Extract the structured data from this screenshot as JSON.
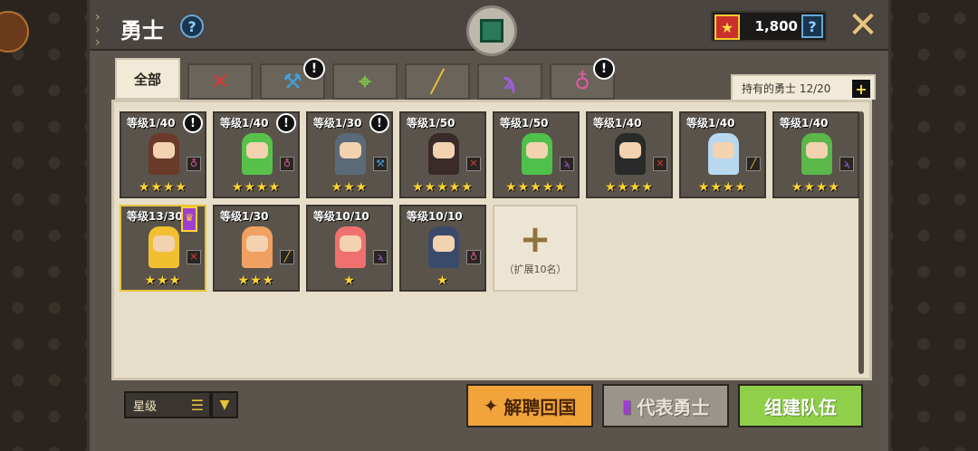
{
  "header": {
    "title": "勇士",
    "currency_amount": "1,800"
  },
  "tabs": [
    {
      "label": "全部",
      "icon": "all"
    },
    {
      "label": "",
      "icon": "sword-icon",
      "color": "#d8383a",
      "glyph": "✕"
    },
    {
      "label": "",
      "icon": "hammer-icon",
      "color": "#3fa0d8",
      "glyph": "⚒",
      "alert": "!"
    },
    {
      "label": "",
      "icon": "bow-icon",
      "color": "#7ac24a",
      "glyph": "⌖"
    },
    {
      "label": "",
      "icon": "rifle-icon",
      "color": "#e8c33a",
      "glyph": "╱"
    },
    {
      "label": "",
      "icon": "staff-icon",
      "color": "#9b5fd8",
      "glyph": "ϡ"
    },
    {
      "label": "",
      "icon": "ring-icon",
      "color": "#e05aa0",
      "glyph": "♁",
      "alert": "!"
    }
  ],
  "owned": {
    "label": "持有的勇士 12/20"
  },
  "heroes": [
    {
      "level": "等级1/40",
      "stars": "★★★★",
      "alert": "!",
      "hair": "#6a3a2a",
      "cls_color": "#e05aa0",
      "cls": "♁"
    },
    {
      "level": "等级1/40",
      "stars": "★★★★",
      "alert": "!",
      "hair": "#56c24a",
      "cls_color": "#e05aa0",
      "cls": "♁"
    },
    {
      "level": "等级1/30",
      "stars": "★★★",
      "alert": "!",
      "hair": "#5a6a78",
      "cls_color": "#3fa0d8",
      "cls": "⚒"
    },
    {
      "level": "等级1/50",
      "stars": "★★★★★",
      "alert": "",
      "hair": "#3a2a2a",
      "cls_color": "#d8383a",
      "cls": "✕"
    },
    {
      "level": "等级1/50",
      "stars": "★★★★★",
      "alert": "",
      "hair": "#4fc04a",
      "cls_color": "#9b5fd8",
      "cls": "ϡ"
    },
    {
      "level": "等级1/40",
      "stars": "★★★★",
      "alert": "",
      "hair": "#2a2a2a",
      "cls_color": "#d8383a",
      "cls": "✕"
    },
    {
      "level": "等级1/40",
      "stars": "★★★★",
      "alert": "",
      "hair": "#b8d8f0",
      "cls_color": "#e8c33a",
      "cls": "╱"
    },
    {
      "level": "等级1/40",
      "stars": "★★★★",
      "alert": "",
      "hair": "#5ab84a",
      "cls_color": "#9b5fd8",
      "cls": "ϡ"
    },
    {
      "level": "等级13/30",
      "stars": "★★★",
      "alert": "",
      "hair": "#f0c030",
      "cls_color": "#d8383a",
      "cls": "✕",
      "representative": true
    },
    {
      "level": "等级1/30",
      "stars": "★★★",
      "alert": "",
      "hair": "#f0a060",
      "cls_color": "#e8c33a",
      "cls": "╱"
    },
    {
      "level": "等级10/10",
      "stars": "★",
      "alert": "",
      "hair": "#f07070",
      "cls_color": "#9b5fd8",
      "cls": "ϡ"
    },
    {
      "level": "等级10/10",
      "stars": "★",
      "alert": "",
      "hair": "#3a4a6a",
      "cls_color": "#e05aa0",
      "cls": "♁"
    }
  ],
  "expand": {
    "label": "（扩展10名）"
  },
  "sort": {
    "label": "星级"
  },
  "buttons": {
    "dismiss": "解聘回国",
    "representative": "代表勇士",
    "team": "组建队伍"
  }
}
